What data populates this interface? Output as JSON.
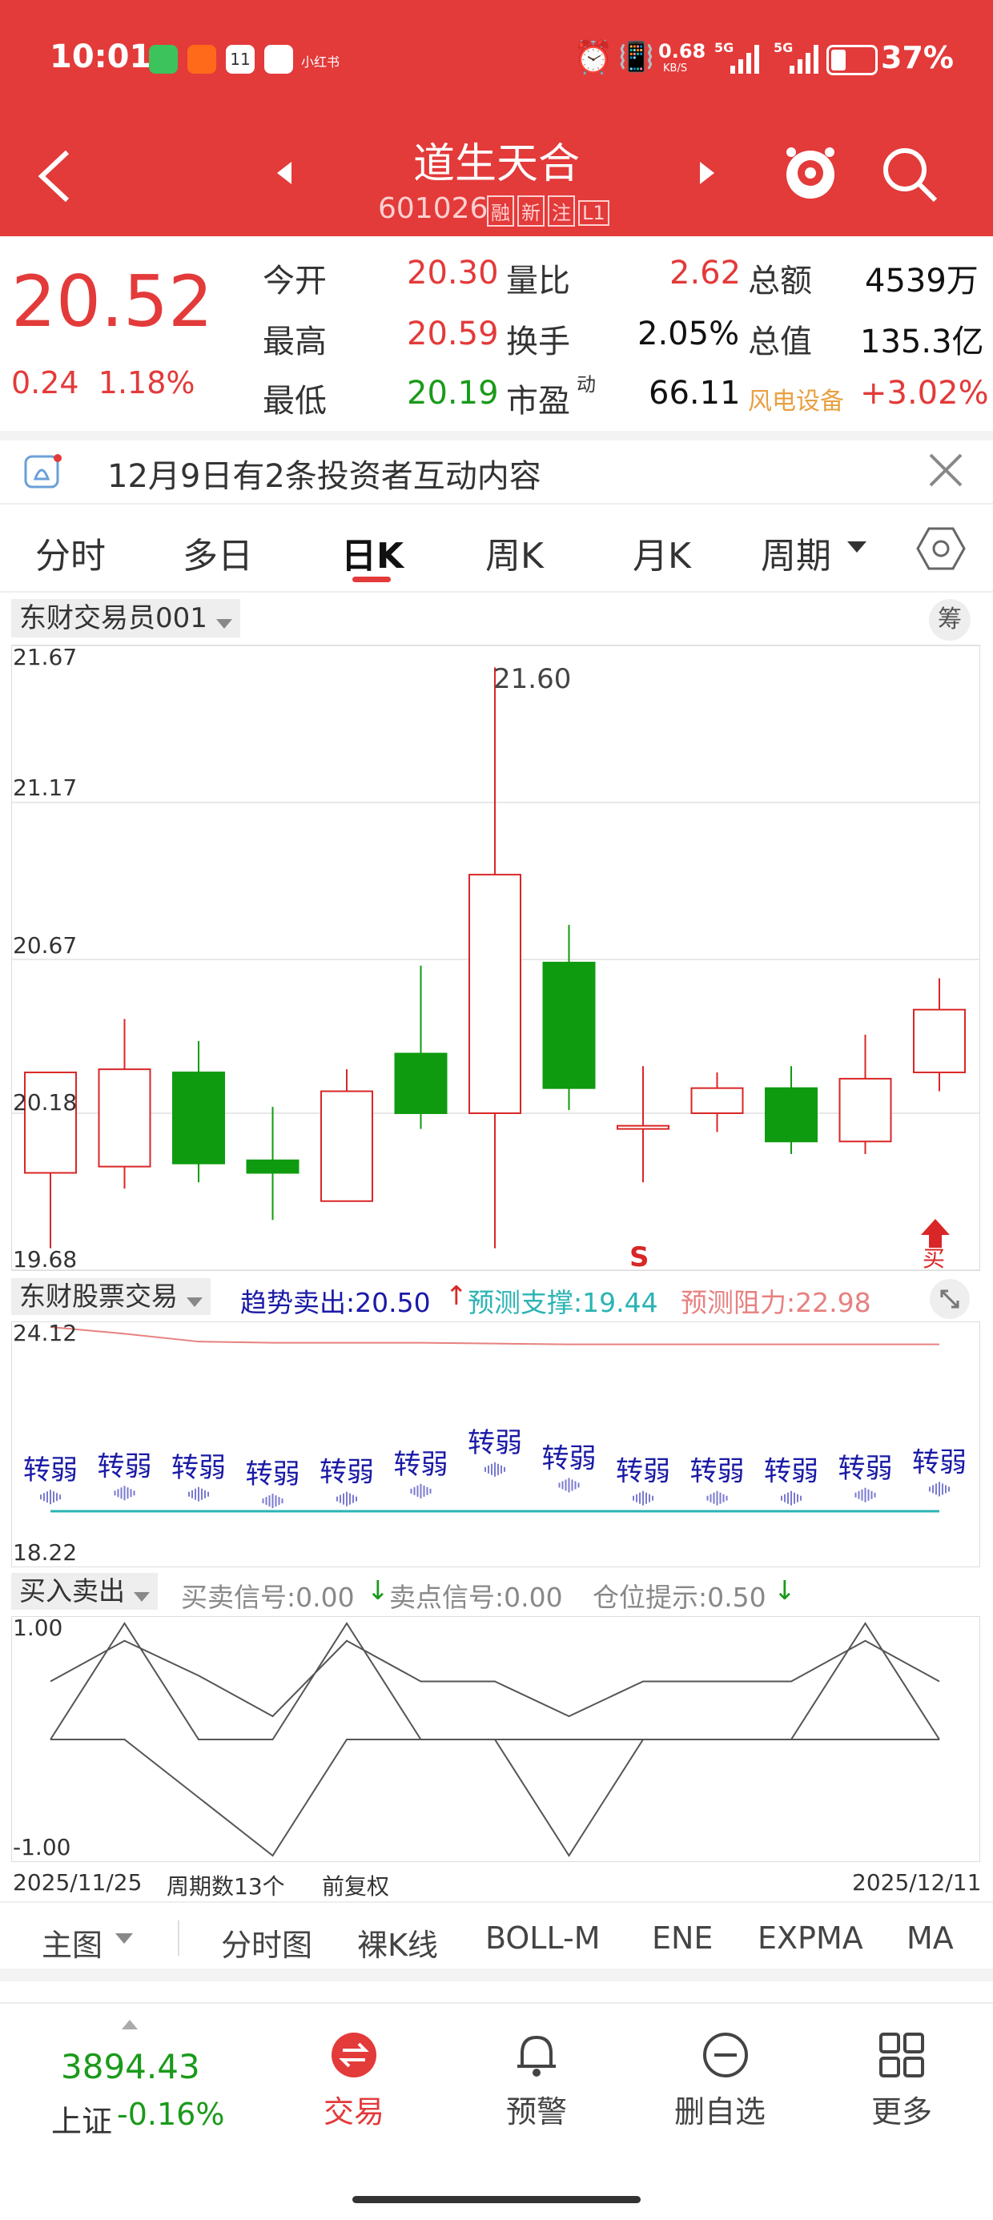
{
  "status_bar": {
    "time": "10:01",
    "speed": "0.68",
    "speed_unit": "KB/S",
    "net1": "5G",
    "net2": "5G",
    "battery": "37%",
    "app_badge": "11",
    "app_tag": "小红书"
  },
  "header": {
    "title": "道生天合",
    "code": "601026",
    "tags": [
      "融",
      "新",
      "注",
      "L1"
    ]
  },
  "quote": {
    "price": "20.52",
    "change": "0.24",
    "change_pct": "1.18%",
    "rows": [
      {
        "l1": "今开",
        "v1": "20.30",
        "l2": "量比",
        "v2": "2.62",
        "l3": "总额",
        "v3": "4539万"
      },
      {
        "l1": "最高",
        "v1": "20.59",
        "l2": "换手",
        "v2": "2.05%",
        "l3": "总值",
        "v3": "135.3亿"
      },
      {
        "l1": "最低",
        "v1": "20.19",
        "l2": "市盈",
        "l2_sup": "动",
        "v2": "66.11",
        "l3": "风电设备",
        "v3": "+3.02%"
      }
    ]
  },
  "notice": {
    "text": "12月9日有2条投资者互动内容"
  },
  "tabs": [
    "分时",
    "多日",
    "日K",
    "周K",
    "月K",
    "周期"
  ],
  "active_tab": 2,
  "main_chart": {
    "indicator_label": "东财交易员001",
    "chip_label": "筹",
    "price_labels": [
      "21.67",
      "21.17",
      "20.67",
      "20.18",
      "19.68"
    ],
    "high_marker": "21.60",
    "sell_marker": "S",
    "buy_marker": "买"
  },
  "chart_data": {
    "type": "candlestick",
    "ylim": [
      19.68,
      21.67
    ],
    "ohlc": [
      {
        "o": 20.31,
        "h": 20.31,
        "l": 19.75,
        "c": 19.99,
        "color": "red"
      },
      {
        "o": 20.01,
        "h": 20.48,
        "l": 19.94,
        "c": 20.32,
        "color": "red"
      },
      {
        "o": 20.31,
        "h": 20.41,
        "l": 19.96,
        "c": 20.02,
        "color": "green"
      },
      {
        "o": 20.03,
        "h": 20.2,
        "l": 19.84,
        "c": 19.99,
        "color": "green"
      },
      {
        "o": 19.9,
        "h": 20.32,
        "l": 19.9,
        "c": 20.25,
        "color": "red"
      },
      {
        "o": 20.37,
        "h": 20.65,
        "l": 20.13,
        "c": 20.18,
        "color": "green"
      },
      {
        "o": 20.18,
        "h": 21.6,
        "l": 19.75,
        "c": 20.94,
        "color": "red"
      },
      {
        "o": 20.66,
        "h": 20.78,
        "l": 20.19,
        "c": 20.26,
        "color": "green"
      },
      {
        "o": 20.13,
        "h": 20.33,
        "l": 19.96,
        "c": 20.14,
        "color": "red"
      },
      {
        "o": 20.18,
        "h": 20.31,
        "l": 20.12,
        "c": 20.26,
        "color": "red"
      },
      {
        "o": 20.26,
        "h": 20.33,
        "l": 20.05,
        "c": 20.09,
        "color": "green"
      },
      {
        "o": 20.09,
        "h": 20.43,
        "l": 20.05,
        "c": 20.29,
        "color": "red"
      },
      {
        "o": 20.31,
        "h": 20.61,
        "l": 20.25,
        "c": 20.51,
        "color": "red"
      }
    ],
    "x_start": "2025/11/25",
    "x_end": "2025/12/11",
    "period_count": "周期数13个",
    "adjust": "前复权"
  },
  "trend_panel": {
    "label": "东财股票交易",
    "trend_text": "趋势卖出:20.50",
    "support_text": "预测支撑:19.44",
    "resist_text": "预测阻力:22.98",
    "ymax": "24.12",
    "ymin": "18.22",
    "line_values": [
      24.12,
      23.95,
      23.75,
      23.72,
      23.72,
      23.72,
      23.7,
      23.68,
      23.68,
      23.68,
      23.68,
      23.68,
      23.68
    ],
    "support_value": 19.44,
    "signal_text": "转弱",
    "signal_levels": [
      20.25,
      20.35,
      20.32,
      20.15,
      20.2,
      20.4,
      20.95,
      20.55,
      20.22,
      20.22,
      20.22,
      20.3,
      20.45
    ]
  },
  "bs_panel": {
    "label": "买入卖出",
    "buy_signal": "买卖信号:0.00",
    "sell_signal": "卖点信号:0.00",
    "position": "仓位提示:0.50",
    "ymax": "1.00",
    "ymin": "-1.00",
    "line_a": [
      0.0,
      1.0,
      0.0,
      0.0,
      1.0,
      0.0,
      0.0,
      0.0,
      0.0,
      0.0,
      0.0,
      1.0,
      0.0
    ],
    "line_b": [
      0.5,
      0.85,
      0.55,
      0.2,
      0.85,
      0.5,
      0.5,
      0.2,
      0.5,
      0.5,
      0.5,
      0.85,
      0.5
    ],
    "line_c": [
      0.0,
      0.0,
      -0.5,
      -1.0,
      0.0,
      0.0,
      0.0,
      -1.0,
      0.0,
      0.0,
      0.0,
      0.0,
      0.0
    ]
  },
  "indicator_bar": [
    "主图",
    "分时图",
    "裸K线",
    "BOLL-M",
    "ENE",
    "EXPMA",
    "MA"
  ],
  "bottom_nav": {
    "index_value": "3894.43",
    "index_name": "上证",
    "index_change": "-0.16%",
    "items": [
      "交易",
      "预警",
      "删自选",
      "更多"
    ]
  },
  "colors": {
    "brand": "#e33a3a",
    "up": "#d92626",
    "down": "#0f9b0f",
    "support": "#2bb3b3",
    "trend": "#e88080",
    "signal_text": "#1a1aa6"
  }
}
